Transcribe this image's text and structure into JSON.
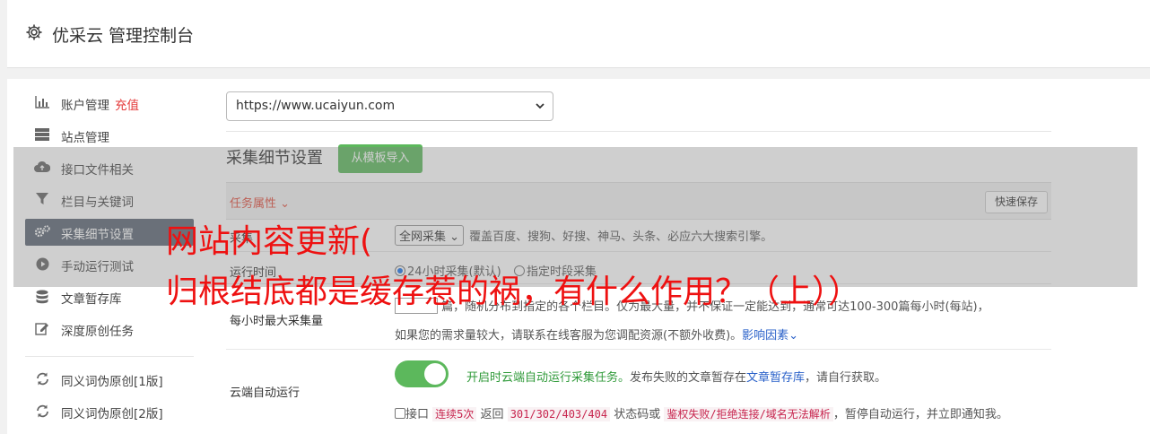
{
  "header": {
    "title": "优采云 管理控制台"
  },
  "sidebar": {
    "items": [
      {
        "label": "账户管理",
        "extra": "充值",
        "icon": "bar-chart-icon"
      },
      {
        "label": "站点管理",
        "icon": "server-icon"
      },
      {
        "label": "接口文件相关",
        "icon": "cloud-upload-icon"
      },
      {
        "label": "栏目与关键词",
        "icon": "filter-icon"
      },
      {
        "label": "采集细节设置",
        "icon": "gears-icon"
      },
      {
        "label": "手动运行测试",
        "icon": "play-icon"
      },
      {
        "label": "文章暂存库",
        "icon": "database-icon"
      },
      {
        "label": "深度原创任务",
        "icon": "edit-icon"
      },
      {
        "label": "同义词伪原创[1版]",
        "icon": "refresh-icon"
      },
      {
        "label": "同义词伪原创[2版]",
        "icon": "refresh-icon"
      }
    ],
    "active_index": 4
  },
  "main": {
    "site_select": {
      "value": "https://www.ucaiyun.com"
    },
    "section_title": "采集细节设置",
    "template_button": "从模板导入",
    "task_attr_label": "任务属性",
    "quick_save": "快速保存",
    "mode_row": {
      "label": "采集",
      "select_value": "全网采集",
      "desc": "覆盖百度、搜狗、好搜、神马、头条、必应六大搜索引擎。"
    },
    "time_row": {
      "label": "运行时间",
      "opt1": "24小时采集(默认)",
      "opt2": "指定时段采集"
    },
    "max_row": {
      "label": "每小时最大采集量",
      "line1_a": "篇，随机分布到指定的各个栏目。仅为最大量，并不保证一定能达到，通常可达100-300篇每小时(每站)，",
      "line2": "如果您的需求量较大，请联系在线客服为您调配资源(不额外收费)。",
      "line2_link": "影响因素"
    },
    "cloud_row": {
      "label": "云端自动运行",
      "toggle_on": true,
      "line1_green": "开启时云端自动运行采集任务。",
      "line1_b": "发布失败的文章暂存在",
      "line1_link": "文章暂存库",
      "line1_c": "，请自行获取。",
      "line2_a": "接口",
      "line2_code1": "连续5次",
      "line2_b": "返回",
      "line2_code2": "301/302/403/404",
      "line2_c": "状态码或",
      "line2_code3": "鉴权失败/拒绝连接/域名无法解析",
      "line2_d": "，暂停自动运行，并立即通知我。"
    }
  },
  "overlay": {
    "line1": "网站内容更新(",
    "line2": "归根结底都是缓存惹的祸，有什么作用？（上））"
  }
}
